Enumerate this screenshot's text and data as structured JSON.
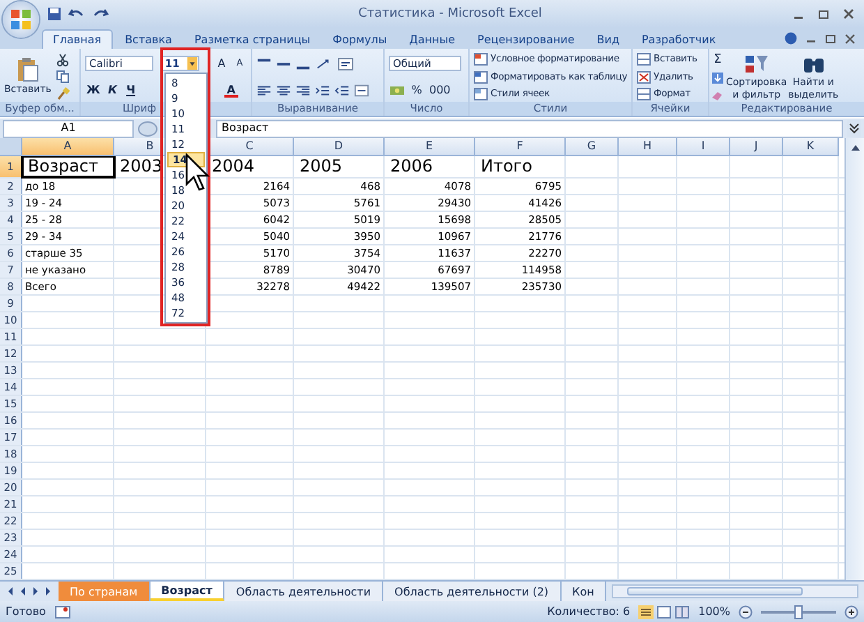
{
  "window": {
    "title": "Статистика - Microsoft Excel"
  },
  "tabs": [
    {
      "label": "Главная",
      "selected": true
    },
    {
      "label": "Вставка",
      "selected": false
    },
    {
      "label": "Разметка страницы",
      "selected": false
    },
    {
      "label": "Формулы",
      "selected": false
    },
    {
      "label": "Данные",
      "selected": false
    },
    {
      "label": "Рецензирование",
      "selected": false
    },
    {
      "label": "Вид",
      "selected": false
    },
    {
      "label": "Разработчик",
      "selected": false
    }
  ],
  "ribbon": {
    "clipboard": {
      "paste_label": "Вставить",
      "group_label": "Буфер обм..."
    },
    "font": {
      "name": "Calibri",
      "size": "11",
      "grow": "A",
      "shrink": "A",
      "bold": "Ж",
      "italic": "К",
      "underline": "Ч",
      "color_button": "A",
      "group_label": "Шриф"
    },
    "alignment": {
      "group_label": "Выравнивание"
    },
    "number": {
      "format": "Общий",
      "percent": "%",
      "thousands": "000",
      "group_label": "Число"
    },
    "styles": {
      "items": [
        "Условное форматирование",
        "Форматировать как таблицу",
        "Стили ячеек"
      ],
      "group_label": "Стили"
    },
    "cells": {
      "items": [
        "Вставить",
        "Удалить",
        "Формат"
      ],
      "group_label": "Ячейки"
    },
    "editing": {
      "sum": "Σ",
      "sort": [
        "Сортировка",
        "и фильтр"
      ],
      "find": [
        "Найти и",
        "выделить"
      ],
      "group_label": "Редактирование"
    }
  },
  "font_size_dropdown": {
    "items": [
      {
        "label": "8",
        "selected": false
      },
      {
        "label": "9",
        "selected": false
      },
      {
        "label": "10",
        "selected": false
      },
      {
        "label": "11",
        "selected": false
      },
      {
        "label": "12",
        "selected": false
      },
      {
        "label": "14",
        "selected": true
      },
      {
        "label": "16",
        "selected": false
      },
      {
        "label": "18",
        "selected": false
      },
      {
        "label": "20",
        "selected": false
      },
      {
        "label": "22",
        "selected": false
      },
      {
        "label": "24",
        "selected": false
      },
      {
        "label": "26",
        "selected": false
      },
      {
        "label": "28",
        "selected": false
      },
      {
        "label": "36",
        "selected": false
      },
      {
        "label": "48",
        "selected": false
      },
      {
        "label": "72",
        "selected": false
      }
    ]
  },
  "formula_bar": {
    "name_box": "A1",
    "value": "Возраст"
  },
  "grid": {
    "columns": [
      {
        "label": "A",
        "selected": true
      },
      {
        "label": "B",
        "selected": false
      },
      {
        "label": "C",
        "selected": false
      },
      {
        "label": "D",
        "selected": false
      },
      {
        "label": "E",
        "selected": false
      },
      {
        "label": "F",
        "selected": false
      },
      {
        "label": "G",
        "selected": false
      },
      {
        "label": "H",
        "selected": false
      },
      {
        "label": "I",
        "selected": false
      },
      {
        "label": "J",
        "selected": false
      },
      {
        "label": "K",
        "selected": false
      }
    ],
    "rows": [
      {
        "number": "1",
        "kind": "heading",
        "selected": true,
        "cells": [
          "Возраст",
          "2003",
          "2004",
          "2005",
          "2006",
          "Итого"
        ]
      },
      {
        "number": "2",
        "kind": "data",
        "selected": false,
        "cells": [
          "до 18",
          null,
          "2164",
          "468",
          "4078",
          "6795"
        ]
      },
      {
        "number": "3",
        "kind": "data",
        "selected": false,
        "cells": [
          "19 - 24",
          null,
          "5073",
          "5761",
          "29430",
          "41426"
        ]
      },
      {
        "number": "4",
        "kind": "data",
        "selected": false,
        "cells": [
          "25 - 28",
          null,
          "6042",
          "5019",
          "15698",
          "28505"
        ]
      },
      {
        "number": "5",
        "kind": "data",
        "selected": false,
        "cells": [
          "29 - 34",
          null,
          "5040",
          "3950",
          "10967",
          "21776"
        ]
      },
      {
        "number": "6",
        "kind": "data",
        "selected": false,
        "cells": [
          "старше 35",
          null,
          "5170",
          "3754",
          "11637",
          "22270"
        ]
      },
      {
        "number": "7",
        "kind": "data",
        "selected": false,
        "cells": [
          "не указано",
          null,
          "8789",
          "30470",
          "67697",
          "114958"
        ]
      },
      {
        "number": "8",
        "kind": "data",
        "selected": false,
        "cells": [
          "Всего",
          null,
          "32278",
          "49422",
          "139507",
          "235730"
        ]
      },
      {
        "number": "9",
        "kind": "data",
        "selected": false,
        "cells": []
      },
      {
        "number": "10",
        "kind": "data",
        "selected": false,
        "cells": []
      },
      {
        "number": "11",
        "kind": "data",
        "selected": false,
        "cells": []
      },
      {
        "number": "12",
        "kind": "data",
        "selected": false,
        "cells": []
      },
      {
        "number": "13",
        "kind": "data",
        "selected": false,
        "cells": []
      },
      {
        "number": "14",
        "kind": "data",
        "selected": false,
        "cells": []
      },
      {
        "number": "15",
        "kind": "data",
        "selected": false,
        "cells": []
      },
      {
        "number": "16",
        "kind": "data",
        "selected": false,
        "cells": []
      },
      {
        "number": "17",
        "kind": "data",
        "selected": false,
        "cells": []
      },
      {
        "number": "18",
        "kind": "data",
        "selected": false,
        "cells": []
      },
      {
        "number": "19",
        "kind": "data",
        "selected": false,
        "cells": []
      },
      {
        "number": "20",
        "kind": "data",
        "selected": false,
        "cells": []
      },
      {
        "number": "21",
        "kind": "data",
        "selected": false,
        "cells": []
      },
      {
        "number": "22",
        "kind": "data",
        "selected": false,
        "cells": []
      },
      {
        "number": "23",
        "kind": "data",
        "selected": false,
        "cells": []
      },
      {
        "number": "24",
        "kind": "data",
        "selected": false,
        "cells": []
      },
      {
        "number": "25",
        "kind": "data",
        "selected": false,
        "cells": []
      }
    ]
  },
  "sheet_tabs": [
    {
      "label": "По странам",
      "selected": false,
      "color": "#f08c3c"
    },
    {
      "label": "Возраст",
      "selected": true
    },
    {
      "label": "Область деятельности",
      "selected": false
    },
    {
      "label": "Область деятельности (2)",
      "selected": false
    },
    {
      "label": "Кон",
      "selected": false
    }
  ],
  "status_bar": {
    "status": "Готово",
    "count": "Количество: 6",
    "zoom": "100%",
    "zoom_slider": {
      "level": 0.5
    }
  }
}
